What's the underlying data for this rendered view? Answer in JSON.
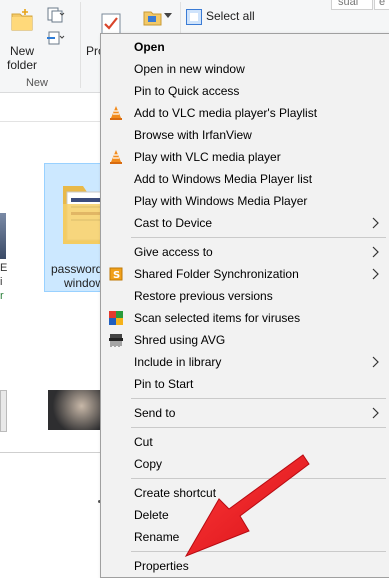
{
  "ribbon": {
    "new_folder_label_line1": "New",
    "new_folder_label_line2": "folder",
    "group_new_label": "New",
    "properties_partial_label": "Pro",
    "select_all_label": "Select all",
    "tab_partial_1": "sual",
    "tab_partial_2": "e"
  },
  "explorer": {
    "selected_item_line1": "password",
    "selected_item_line2": "window",
    "left_item_line1": "E",
    "left_item_line2": "i",
    "left_item_line3": "r"
  },
  "context_menu": {
    "items": [
      {
        "label": "Open",
        "bold": true,
        "icon": null,
        "submenu": false
      },
      {
        "label": "Open in new window",
        "icon": null,
        "submenu": false
      },
      {
        "label": "Pin to Quick access",
        "icon": null,
        "submenu": false
      },
      {
        "label": "Add to VLC media player's Playlist",
        "icon": "vlc-cone-icon",
        "submenu": false
      },
      {
        "label": "Browse with IrfanView",
        "icon": null,
        "submenu": false
      },
      {
        "label": "Play with VLC media player",
        "icon": "vlc-cone-icon",
        "submenu": false
      },
      {
        "label": "Add to Windows Media Player list",
        "icon": null,
        "submenu": false
      },
      {
        "label": "Play with Windows Media Player",
        "icon": null,
        "submenu": false
      },
      {
        "label": "Cast to Device",
        "icon": null,
        "submenu": true
      },
      {
        "label": "Give access to",
        "icon": null,
        "submenu": true
      },
      {
        "label": "Shared Folder Synchronization",
        "icon": "sync-s-icon",
        "submenu": true
      },
      {
        "label": "Restore previous versions",
        "icon": null,
        "submenu": false
      },
      {
        "label": "Scan selected items for viruses",
        "icon": "avg-shield-icon",
        "submenu": false
      },
      {
        "label": "Shred using AVG",
        "icon": "shredder-icon",
        "submenu": false
      },
      {
        "label": "Include in library",
        "icon": null,
        "submenu": true
      },
      {
        "label": "Pin to Start",
        "icon": null,
        "submenu": false
      },
      {
        "label": "Send to",
        "icon": null,
        "submenu": true
      },
      {
        "label": "Cut",
        "icon": null,
        "submenu": false
      },
      {
        "label": "Copy",
        "icon": null,
        "submenu": false
      },
      {
        "label": "Create shortcut",
        "icon": null,
        "submenu": false
      },
      {
        "label": "Delete",
        "icon": null,
        "submenu": false
      },
      {
        "label": "Rename",
        "icon": null,
        "submenu": false
      },
      {
        "label": "Properties",
        "icon": null,
        "submenu": false
      }
    ]
  },
  "colors": {
    "menu_background": "#f2f2f2",
    "annotation_arrow": "#e8141c",
    "selection_fill": "#cce8ff"
  }
}
